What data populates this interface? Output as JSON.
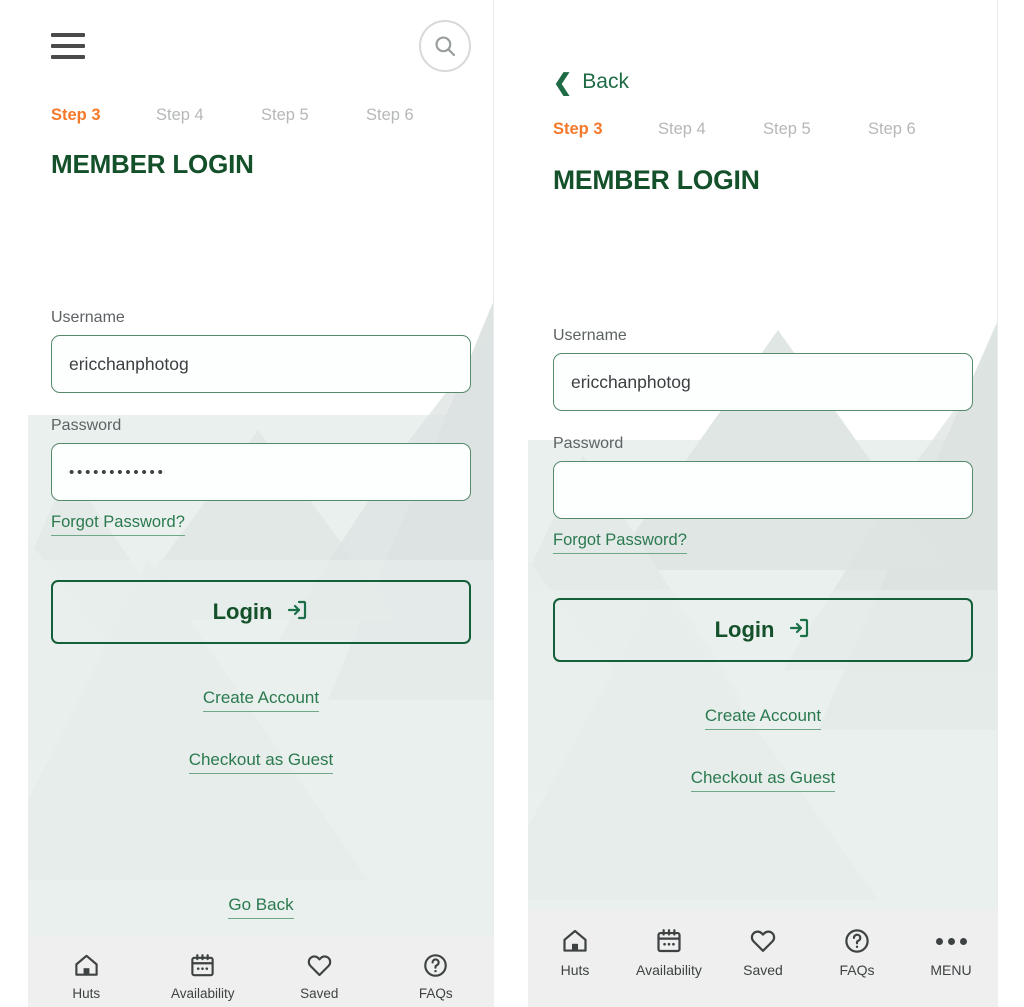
{
  "accent": {
    "orange": "#f4792b",
    "dark_green": "#14512b",
    "link_green": "#2b7a4f",
    "border_green": "#558a6d",
    "muted_gray": "#b6b8b8",
    "nav_bg": "#efefef",
    "scenery_gray": "#dfe5e3"
  },
  "left_panel": {
    "menu_icon": "hamburger-menu-icon",
    "search_icon": "search-icon",
    "steps": [
      {
        "label": "Step 3",
        "active": true
      },
      {
        "label": "Step 4",
        "active": false
      },
      {
        "label": "Step 5",
        "active": false
      },
      {
        "label": "Step 6",
        "active": false
      }
    ],
    "title": "MEMBER LOGIN",
    "form": {
      "username_label": "Username",
      "username_value": "ericchanphotog",
      "username_placeholder": "Username",
      "password_label": "Password",
      "password_value": "••••••••••••",
      "password_placeholder": "Password",
      "forgot_label": "Forgot Password?"
    },
    "login_button": {
      "label": "Login",
      "icon": "login-arrow-icon"
    },
    "links": {
      "create_account": "Create Account",
      "checkout_guest": "Checkout as Guest",
      "go_back": "Go Back"
    },
    "bottom_nav": [
      {
        "label": "Huts",
        "icon": "home-icon"
      },
      {
        "label": "Availability",
        "icon": "calendar-icon"
      },
      {
        "label": "Saved",
        "icon": "heart-icon"
      },
      {
        "label": "FAQs",
        "icon": "question-circle-icon"
      }
    ]
  },
  "right_panel": {
    "back": {
      "label": "Back",
      "icon": "chevron-left-icon"
    },
    "steps": [
      {
        "label": "Step 3",
        "active": true
      },
      {
        "label": "Step 4",
        "active": false
      },
      {
        "label": "Step 5",
        "active": false
      },
      {
        "label": "Step 6",
        "active": false
      }
    ],
    "title": "MEMBER LOGIN",
    "form": {
      "username_label": "Username",
      "username_value": "ericchanphotog",
      "username_placeholder": "Username",
      "password_label": "Password",
      "password_value": "",
      "password_placeholder": "Password",
      "forgot_label": "Forgot Password?"
    },
    "login_button": {
      "label": "Login",
      "icon": "login-arrow-icon"
    },
    "links": {
      "create_account": "Create Account",
      "checkout_guest": "Checkout as Guest"
    },
    "bottom_nav": [
      {
        "label": "Huts",
        "icon": "home-icon"
      },
      {
        "label": "Availability",
        "icon": "calendar-icon"
      },
      {
        "label": "Saved",
        "icon": "heart-icon"
      },
      {
        "label": "FAQs",
        "icon": "question-circle-icon"
      },
      {
        "label": "MENU",
        "icon": "ellipsis-icon"
      }
    ]
  }
}
